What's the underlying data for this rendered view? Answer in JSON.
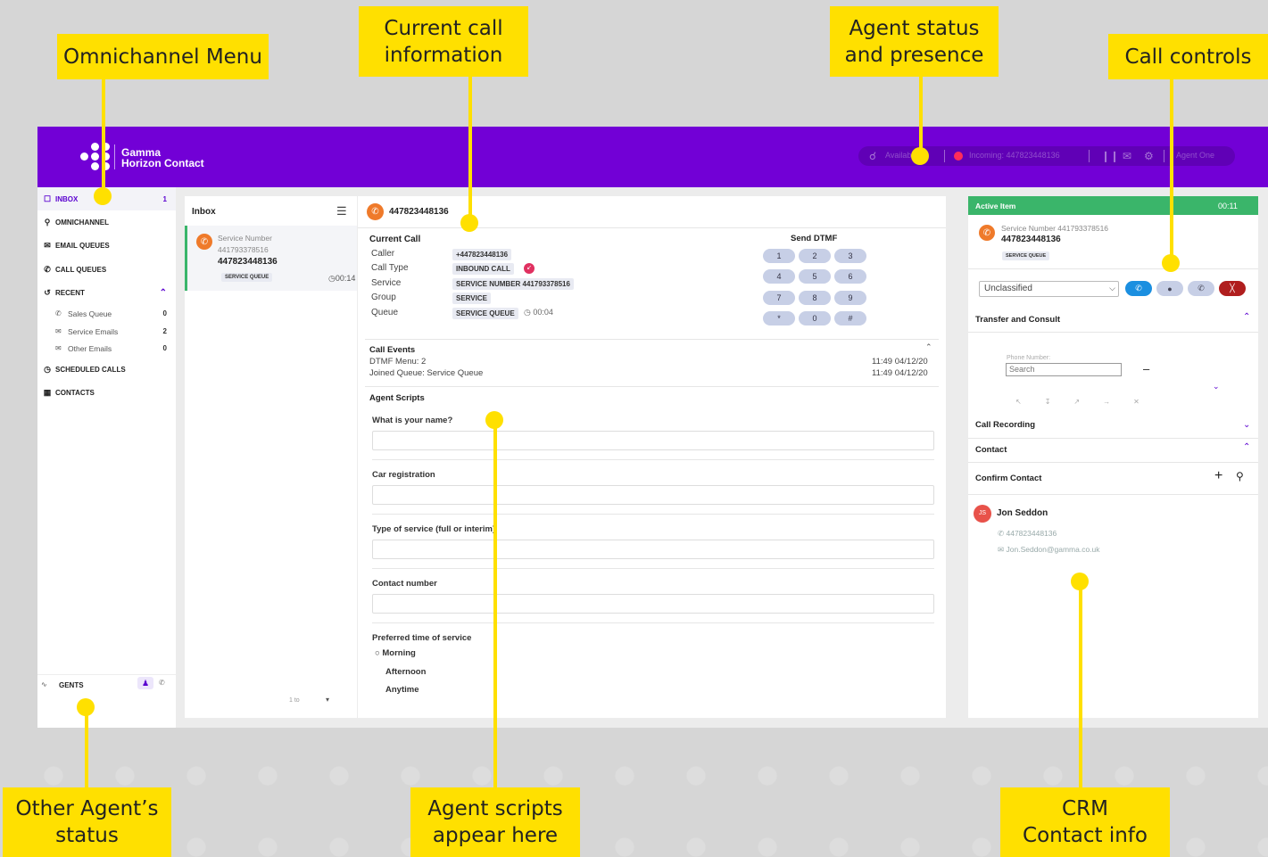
{
  "callouts": {
    "omnichannel_menu": "Omnichannel Menu",
    "current_call_info": "Current call\ninformation",
    "agent_status": "Agent status\nand presence",
    "call_controls": "Call controls",
    "other_agents": "Other Agent’s\nstatus",
    "agent_scripts": "Agent scripts\nappear here",
    "crm_contact": "CRM\nContact info"
  },
  "colors": {
    "brand": "#7200d6",
    "callout": "#ffe000",
    "active_item": "#3ab56a",
    "hangup": "#b01e1e",
    "call_icon": "#ef7a2a"
  },
  "app": {
    "logo_line1": "Gamma",
    "logo_line2": "Horizon Contact",
    "status_bar": {
      "presence_text": "Available",
      "call_text": "Incoming: 447823448136",
      "profile": "Agent One"
    }
  },
  "sidebar": {
    "nav": [
      {
        "icon": "inbox-icon",
        "label": "INBOX",
        "count": "1"
      },
      {
        "icon": "omnichannel-icon",
        "label": "OMNICHANNEL",
        "count": ""
      },
      {
        "icon": "email-icon",
        "label": "EMAIL QUEUES",
        "count": ""
      },
      {
        "icon": "phone-icon",
        "label": "CALL QUEUES",
        "count": ""
      },
      {
        "icon": "history-icon",
        "label": "RECENT",
        "count": ""
      }
    ],
    "recent": [
      {
        "label": "Sales Queue",
        "count": "0"
      },
      {
        "label": "Service Emails",
        "count": "2"
      },
      {
        "label": "Other Emails",
        "count": "0"
      }
    ],
    "nav2": [
      {
        "label": "SCHEDULED CALLS"
      },
      {
        "label": "CONTACTS"
      }
    ],
    "agents_label": "GENTS"
  },
  "inbox": {
    "title": "Inbox",
    "item": {
      "service_number_label": "Service Number",
      "service_number": "441793378516",
      "caller": "447823448136",
      "queue_tag": "SERVICE QUEUE",
      "timer": "00:14"
    },
    "pager": "1 to"
  },
  "call": {
    "header_number": "447823448136",
    "current_call_title": "Current Call",
    "rows": [
      {
        "label": "Caller",
        "value": "+447823448136"
      },
      {
        "label": "Call Type",
        "value": "INBOUND CALL"
      },
      {
        "label": "Service",
        "value": "SERVICE NUMBER 441793378516"
      },
      {
        "label": "Group",
        "value": "SERVICE"
      },
      {
        "label": "Queue",
        "value": "SERVICE QUEUE"
      }
    ],
    "queue_timer": "00:04",
    "dtmf_title": "Send DTMF",
    "dtmf_keys": [
      "1",
      "2",
      "3",
      "4",
      "5",
      "6",
      "7",
      "8",
      "9",
      "*",
      "0",
      "#"
    ],
    "events_title": "Call Events",
    "events": [
      {
        "text": "DTMF Menu: 2",
        "time": "11:49 04/12/20"
      },
      {
        "text": "Joined Queue: Service Queue",
        "time": "11:49 04/12/20"
      }
    ],
    "scripts_title": "Agent Scripts",
    "questions": [
      "What is your name?",
      "Car registration",
      "Type of service (full or interim)",
      "Contact number"
    ],
    "preferred_label": "Preferred time of service",
    "options": [
      "Morning",
      "Afternoon",
      "Anytime"
    ]
  },
  "active": {
    "title": "Active Item",
    "timer": "00:11",
    "service_number": "Service Number 441793378516",
    "caller": "447823448136",
    "tag": "SERVICE QUEUE",
    "classification": "Unclassified",
    "transfer_title": "Transfer and Consult",
    "phone_number_label": "Phone Number:",
    "search_placeholder": "Search",
    "call_recording": "Call Recording",
    "contact": "Contact",
    "confirm_contact": "Confirm Contact",
    "contact_initials": "JS",
    "contact_name": "Jon Seddon",
    "contact_phone": "447823448136",
    "contact_email": "Jon.Seddon@gamma.co.uk"
  }
}
